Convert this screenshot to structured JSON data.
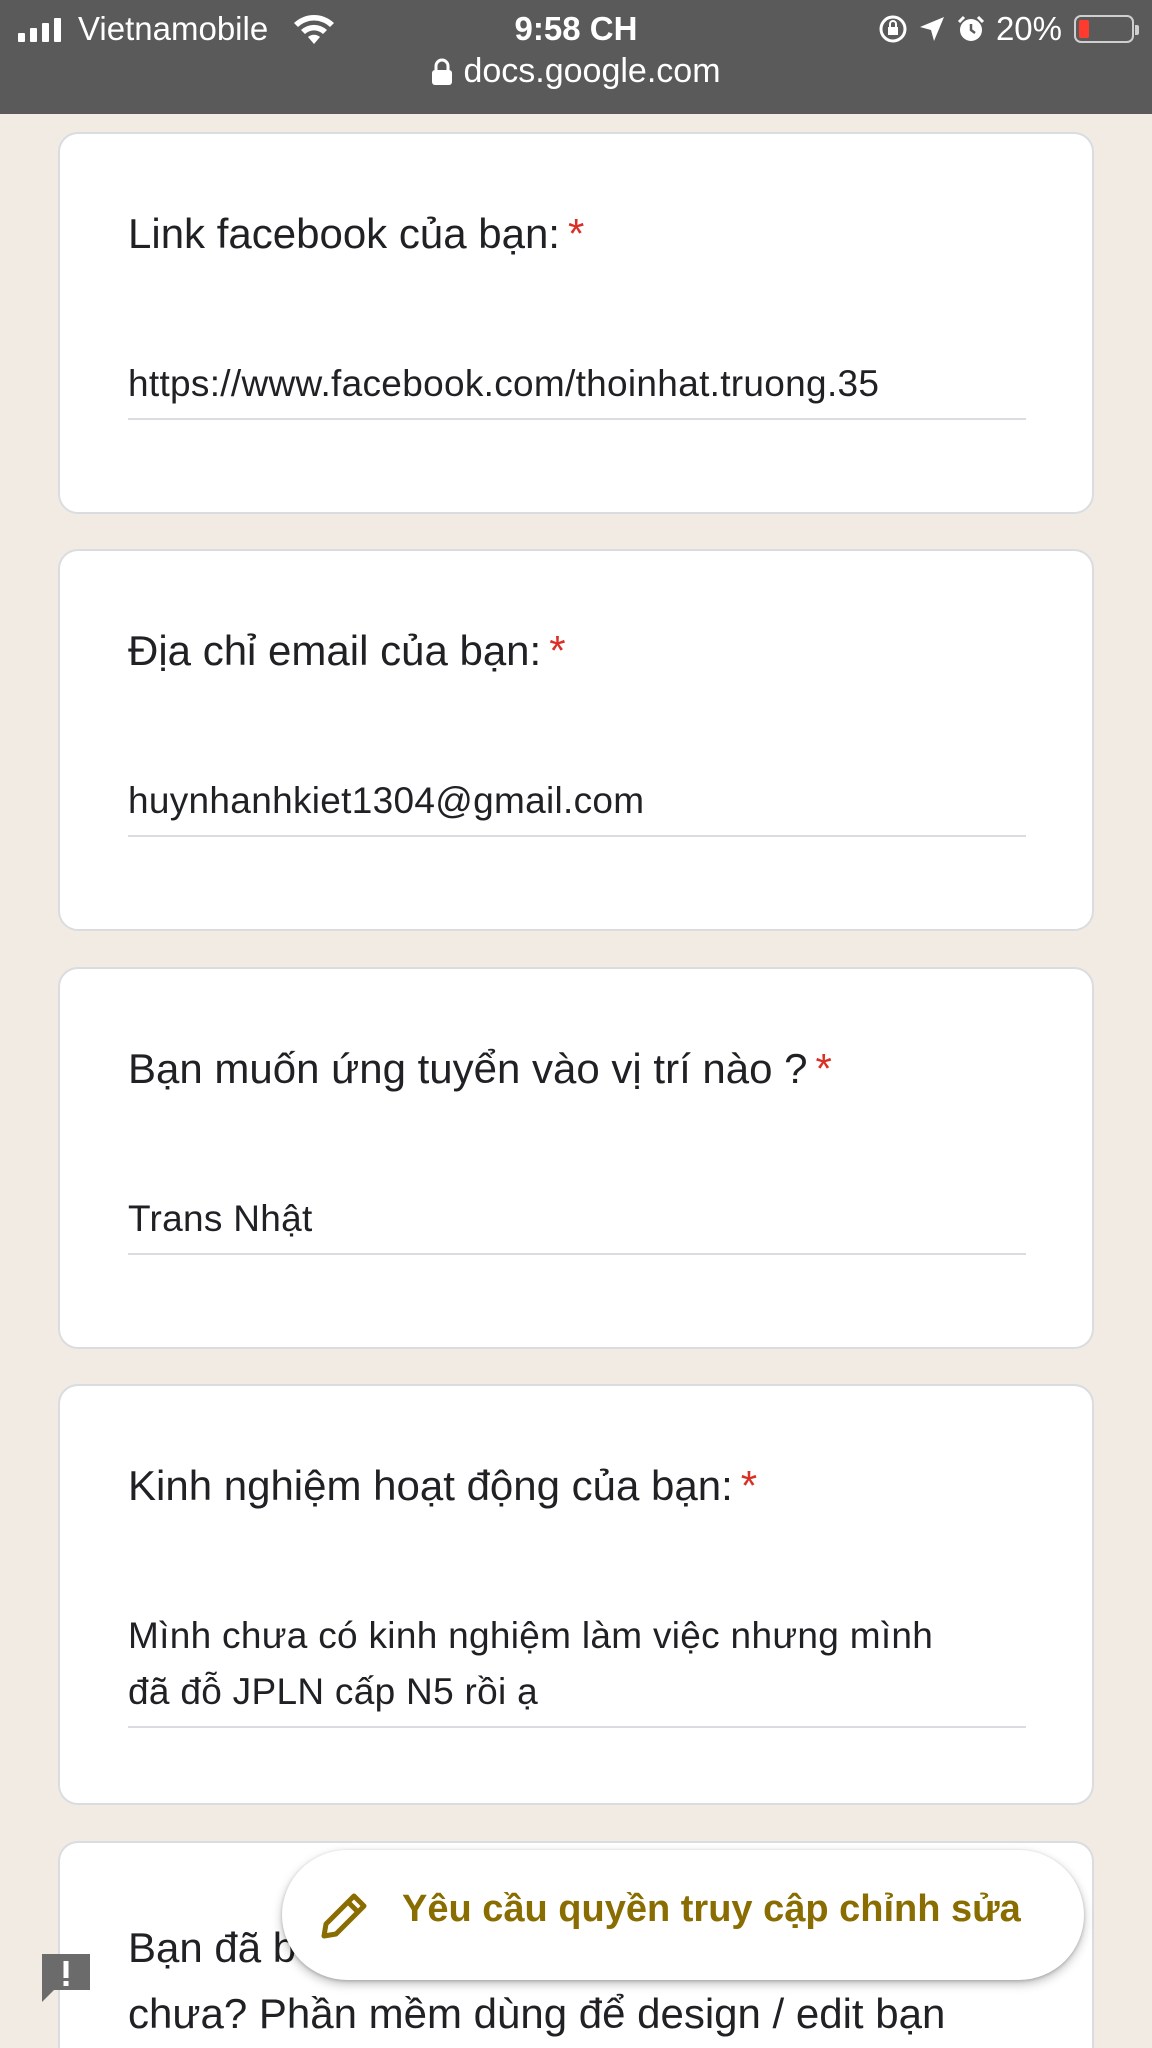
{
  "status_bar": {
    "carrier": "Vietnamobile",
    "time": "9:58 CH",
    "battery": "20%",
    "url": "docs.google.com"
  },
  "questions": [
    {
      "title": "Link facebook của bạn:",
      "required_mark": "*",
      "answer": "https://www.facebook.com/thoinhat.truong.35"
    },
    {
      "title": "Địa chỉ email của bạn:",
      "required_mark": "*",
      "answer": "huynhanhkiet1304@gmail.com"
    },
    {
      "title": "Bạn muốn ứng tuyển vào vị trí nào ?",
      "required_mark": "*",
      "answer": "Trans Nhật"
    },
    {
      "title": "Kinh nghiệm hoạt động của bạn:",
      "required_mark": "*",
      "answer_line1": "Mình chưa có kinh nghiệm làm việc nhưng mình",
      "answer_line2": "đã đỗ JPLN cấp N5 rồi ạ"
    },
    {
      "title_line1_visible": "Bạn đã b",
      "title_line2": "chưa? Phần mềm dùng để design / edit bạn"
    }
  ],
  "fab": {
    "label": "Yêu cầu quyền truy cập chỉnh sửa",
    "icon": "pencil-icon",
    "color": "#8a6d00"
  },
  "feedback_icon": "feedback-icon",
  "colors": {
    "background": "#f1ebe3",
    "required": "#d93025"
  }
}
